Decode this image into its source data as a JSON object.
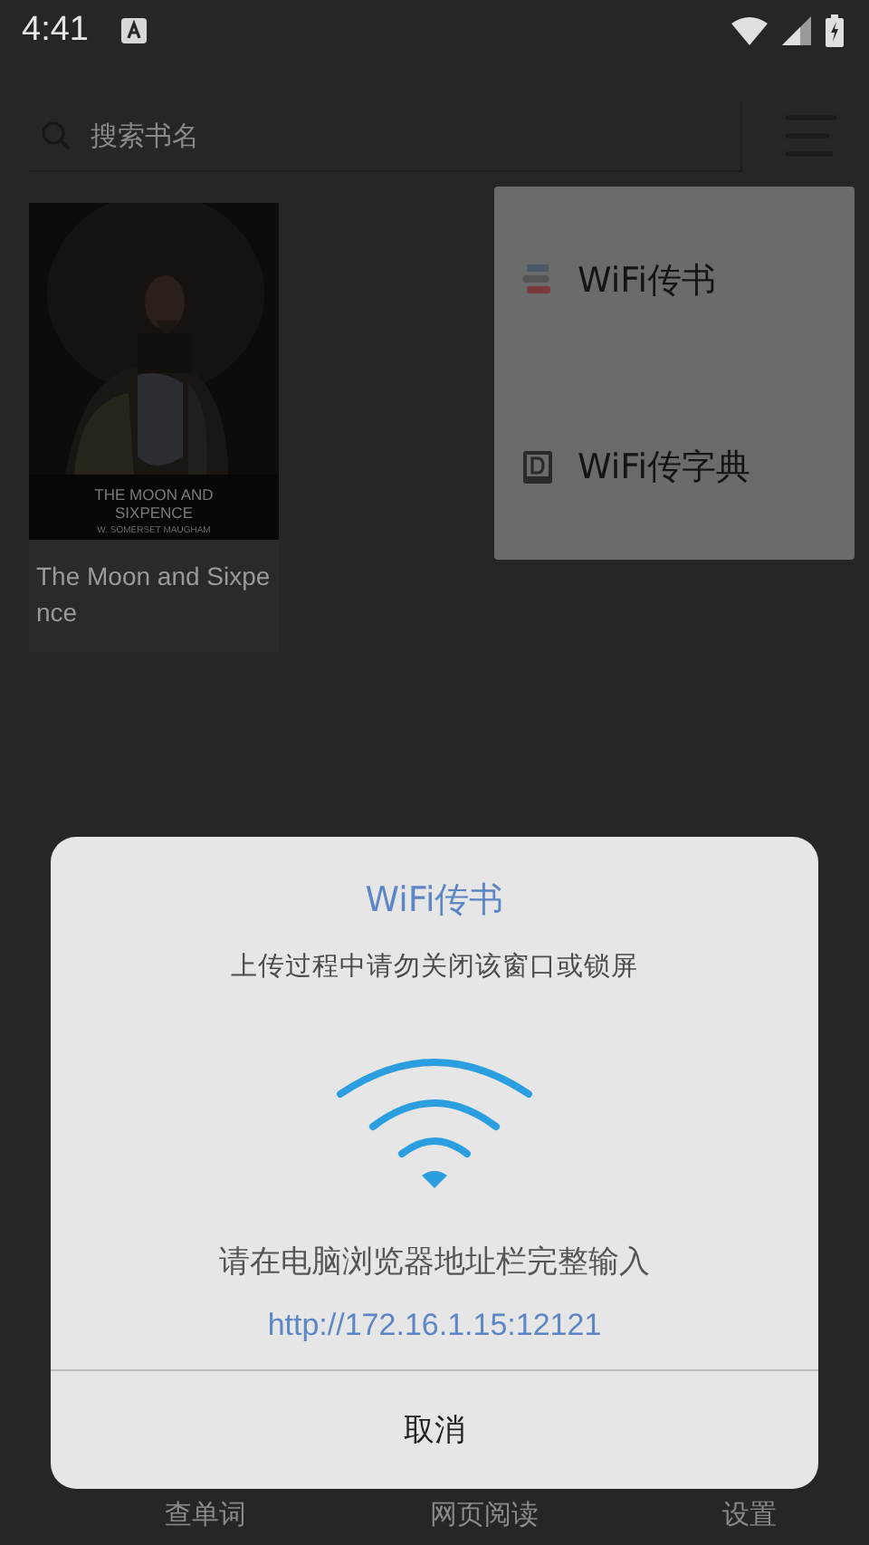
{
  "status_bar": {
    "time": "4:41"
  },
  "search": {
    "placeholder": "搜索书名"
  },
  "books": [
    {
      "title": "The Moon and Sixpence",
      "cover_title": "THE MOON AND SIXPENCE",
      "cover_author": "W. SOMERSET MAUGHAM"
    }
  ],
  "menu": {
    "items": [
      {
        "label": "WiFi传书",
        "kind": "books"
      },
      {
        "label": "WiFi传字典",
        "kind": "dictionary"
      }
    ]
  },
  "bottom_nav": [
    {
      "label": "查单词"
    },
    {
      "label": "网页阅读"
    },
    {
      "label": "设置"
    }
  ],
  "dialog": {
    "title": "WiFi传书",
    "message": "上传过程中请勿关闭该窗口或锁屏",
    "instruction": "请在电脑浏览器地址栏完整输入",
    "url": "http://172.16.1.15:12121",
    "button": "取消"
  }
}
